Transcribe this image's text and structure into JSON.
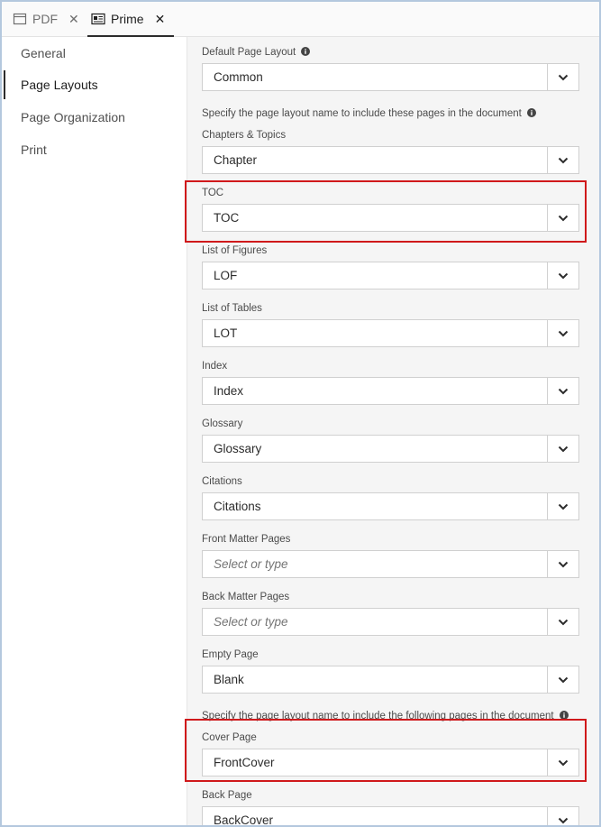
{
  "tabs": [
    {
      "label": "PDF",
      "icon": "window-icon",
      "close": "✕",
      "active": false
    },
    {
      "label": "Prime",
      "icon": "document-icon",
      "close": "✕",
      "active": true
    }
  ],
  "sidebar": {
    "items": [
      {
        "label": "General"
      },
      {
        "label": "Page Layouts",
        "selected": true
      },
      {
        "label": "Page Organization"
      },
      {
        "label": "Print"
      }
    ]
  },
  "content": {
    "default_layout_label": "Default Page Layout",
    "default_layout_value": "Common",
    "specify_text_1": "Specify the page layout name to include these pages in the document",
    "specify_text_2": "Specify the page layout name to include the following pages in the document",
    "fields": [
      {
        "label": "Chapters & Topics",
        "value": "Chapter"
      },
      {
        "label": "TOC",
        "value": "TOC",
        "highlighted": true
      },
      {
        "label": "List of Figures",
        "value": "LOF"
      },
      {
        "label": "List of Tables",
        "value": "LOT"
      },
      {
        "label": "Index",
        "value": "Index"
      },
      {
        "label": "Glossary",
        "value": "Glossary"
      },
      {
        "label": "Citations",
        "value": "Citations"
      },
      {
        "label": "Front Matter Pages",
        "value": "",
        "placeholder": "Select or type"
      },
      {
        "label": "Back Matter Pages",
        "value": "",
        "placeholder": "Select or type"
      },
      {
        "label": "Empty Page",
        "value": "Blank"
      }
    ],
    "cover_page": {
      "label": "Cover Page",
      "value": "FrontCover",
      "highlighted": true
    },
    "back_page": {
      "label": "Back Page",
      "value": "BackCover"
    }
  },
  "colors": {
    "highlight": "#d0191b",
    "window_border": "#b4c8de",
    "content_bg": "#f5f5f5"
  }
}
